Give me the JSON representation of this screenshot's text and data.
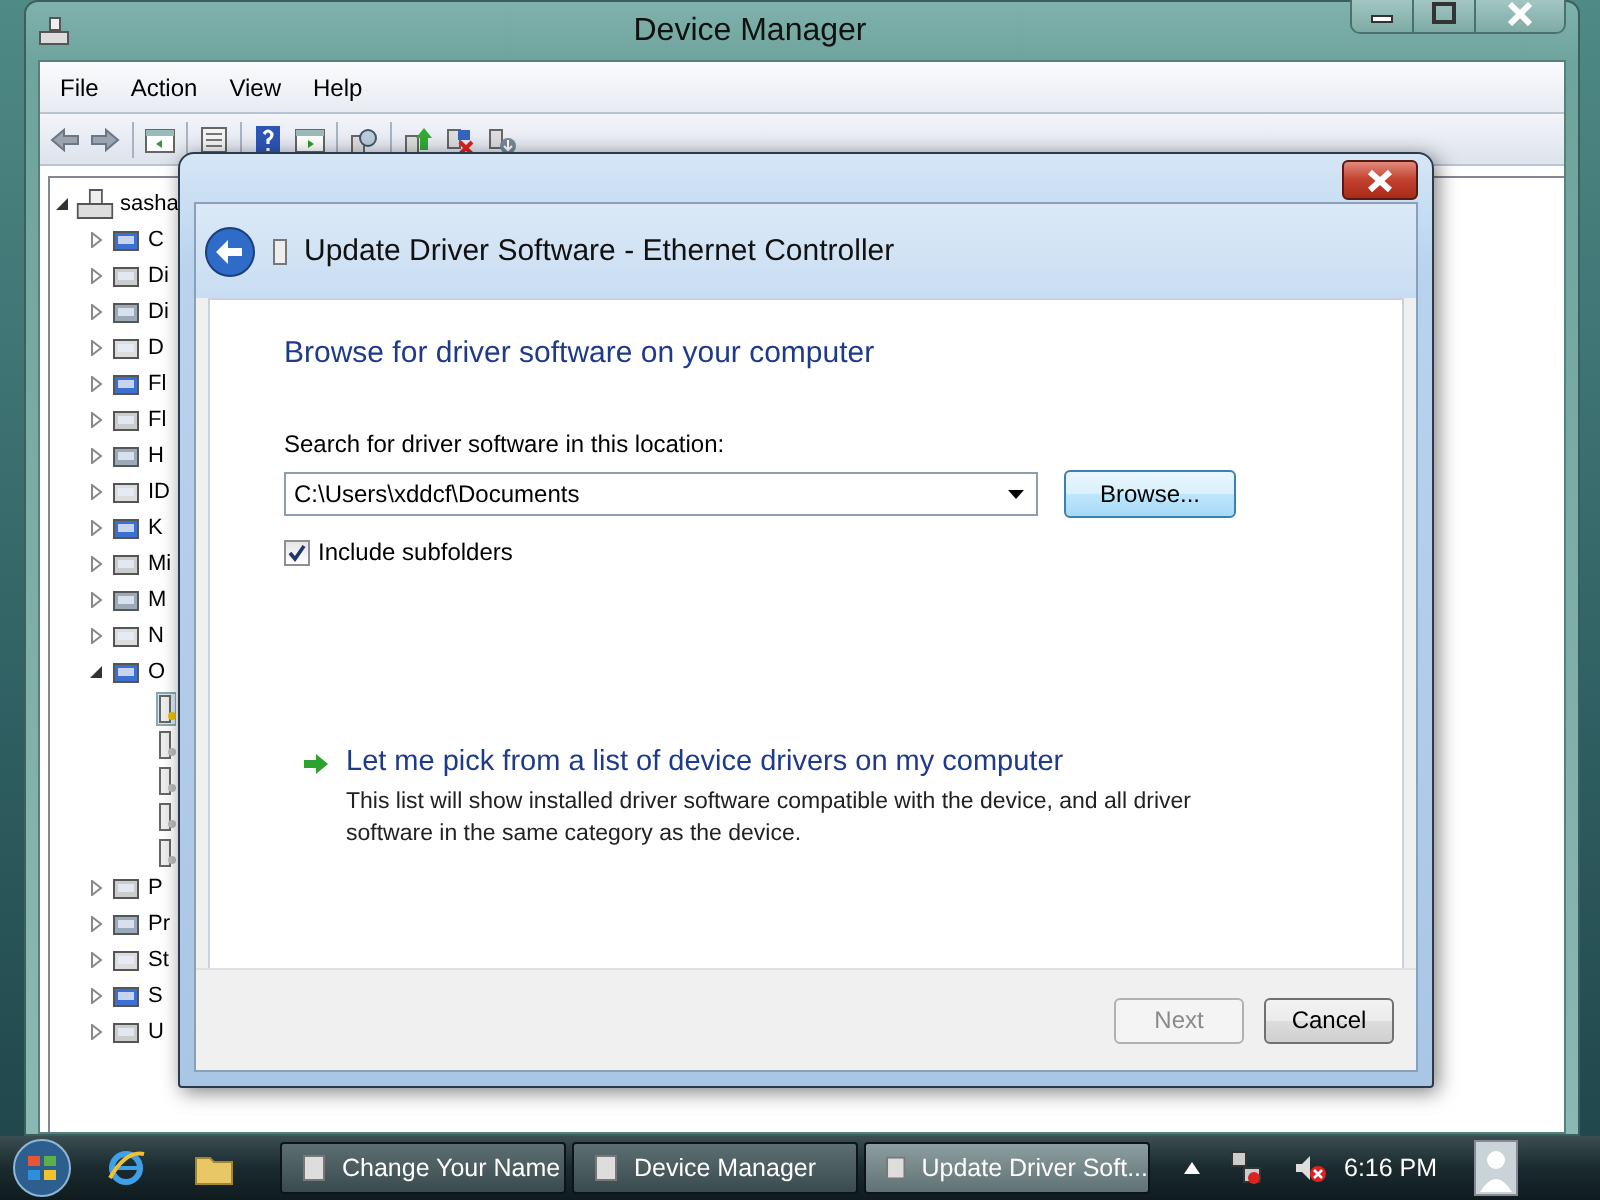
{
  "window": {
    "title": "Device Manager"
  },
  "menu": [
    "File",
    "Action",
    "View",
    "Help"
  ],
  "tree": {
    "label": "sasha",
    "expanded": true,
    "children": [
      {
        "label": "C",
        "expanded": false
      },
      {
        "label": "Di",
        "expanded": false
      },
      {
        "label": "Di",
        "expanded": false
      },
      {
        "label": "D",
        "expanded": false
      },
      {
        "label": "Fl",
        "expanded": false
      },
      {
        "label": "Fl",
        "expanded": false
      },
      {
        "label": "H",
        "expanded": false
      },
      {
        "label": "ID",
        "expanded": false
      },
      {
        "label": "K",
        "expanded": false
      },
      {
        "label": "Mi",
        "expanded": false
      },
      {
        "label": "M",
        "expanded": false
      },
      {
        "label": "N",
        "expanded": false
      },
      {
        "label": "O",
        "expanded": true,
        "children": [
          {
            "selected": true
          },
          {
            "selected": false
          },
          {
            "selected": false
          },
          {
            "selected": false
          },
          {
            "selected": false
          }
        ]
      },
      {
        "label": "P",
        "expanded": false
      },
      {
        "label": "Pr",
        "expanded": false
      },
      {
        "label": "St",
        "expanded": false
      },
      {
        "label": "S",
        "expanded": false
      },
      {
        "label": "U",
        "expanded": false
      }
    ]
  },
  "dialog": {
    "title": "Update Driver Software - Ethernet Controller",
    "heading": "Browse for driver software on your computer",
    "location_label": "Search for driver software in this location:",
    "location": "C:\\Users\\xddcf\\Documents",
    "browse": "Browse...",
    "include_subfolders": {
      "label": "Include subfolders",
      "checked": true
    },
    "option": {
      "title": "Let me pick from a list of device drivers on my computer",
      "description": "This list will show installed driver software compatible with the device, and all driver software in the same category as the device."
    },
    "buttons": [
      {
        "label": "Next",
        "disabled": true
      },
      {
        "label": "Cancel",
        "disabled": false
      }
    ]
  },
  "taskbar": {
    "tasks": [
      {
        "label": "Change Your Name",
        "selected": false
      },
      {
        "label": "Device Manager",
        "selected": false
      },
      {
        "label": "Update Driver Soft...",
        "selected": true
      }
    ],
    "clock": "6:16 PM"
  }
}
